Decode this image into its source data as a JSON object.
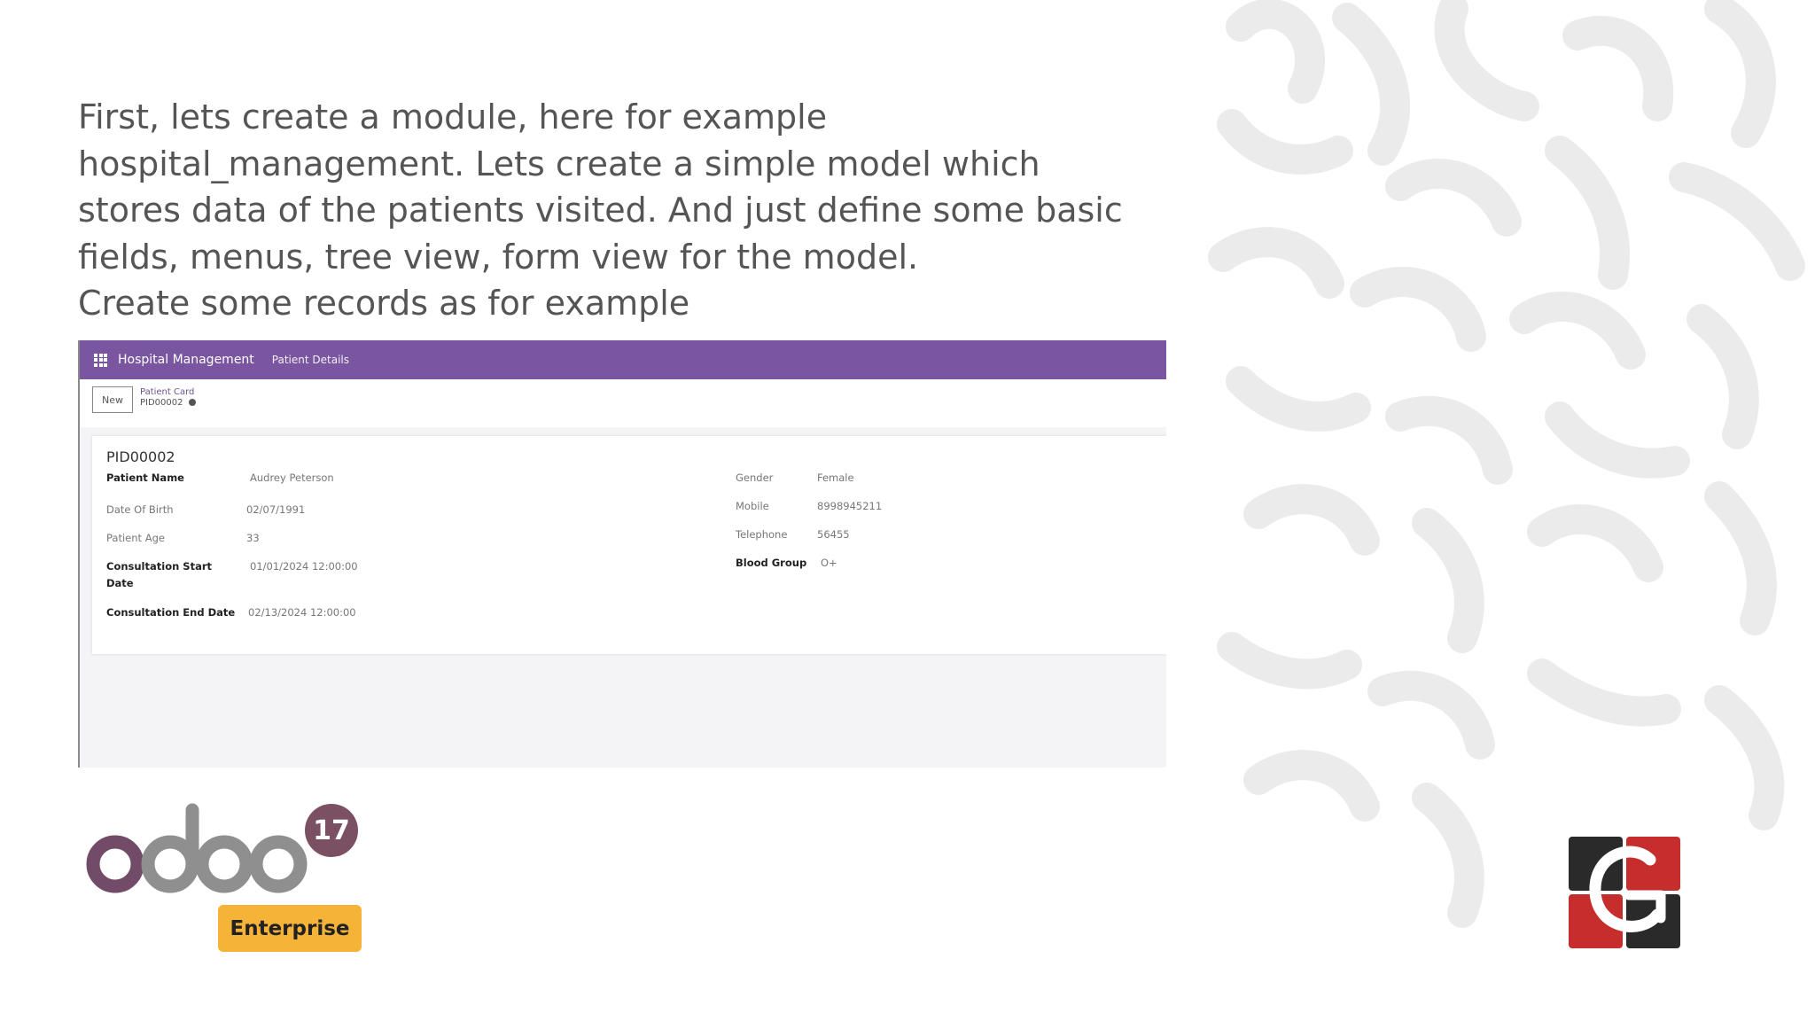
{
  "intro": {
    "line1": "First, lets create a module, here for example",
    "line2": "hospital_management. Lets create a simple model which",
    "line3": "stores data of the patients visited. And just define some basic",
    "line4": "fields, menus, tree view, form view for the model.",
    "line5": "Create some records as for example"
  },
  "odoo": {
    "navbar": {
      "app_name": "Hospital Management",
      "menu_patient_details": "Patient Details"
    },
    "control_panel": {
      "new_label": "New",
      "breadcrumb_parent": "Patient Card",
      "breadcrumb_record": "PID00002"
    },
    "form": {
      "record_id": "PID00002",
      "left_fields": [
        {
          "label": "Patient Name",
          "value": "Audrey Peterson"
        },
        {
          "label": "Date Of Birth",
          "value": "02/07/1991"
        },
        {
          "label": "Patient Age",
          "value": "33"
        },
        {
          "label": "Consultation Start Date",
          "value": "01/01/2024 12:00:00"
        },
        {
          "label": "Consultation End Date",
          "value": "02/13/2024 12:00:00"
        }
      ],
      "right_fields": [
        {
          "label": "Gender",
          "value": "Female"
        },
        {
          "label": "Mobile",
          "value": "8998945211"
        },
        {
          "label": "Telephone",
          "value": "56455"
        },
        {
          "label": "Blood Group",
          "value": "O+"
        }
      ]
    }
  },
  "branding": {
    "odoo_wordmark": "odoo",
    "version_badge": "17",
    "edition_badge": "Enterprise",
    "corner_logo_letter": "C"
  },
  "colors": {
    "navbar": "#7a55a0",
    "intro_text": "#555555",
    "badge_17": "#7b5062",
    "enterprise_badge": "#f5b338",
    "odoo_purple": "#714b67",
    "odoo_grey": "#8f8f8f"
  }
}
